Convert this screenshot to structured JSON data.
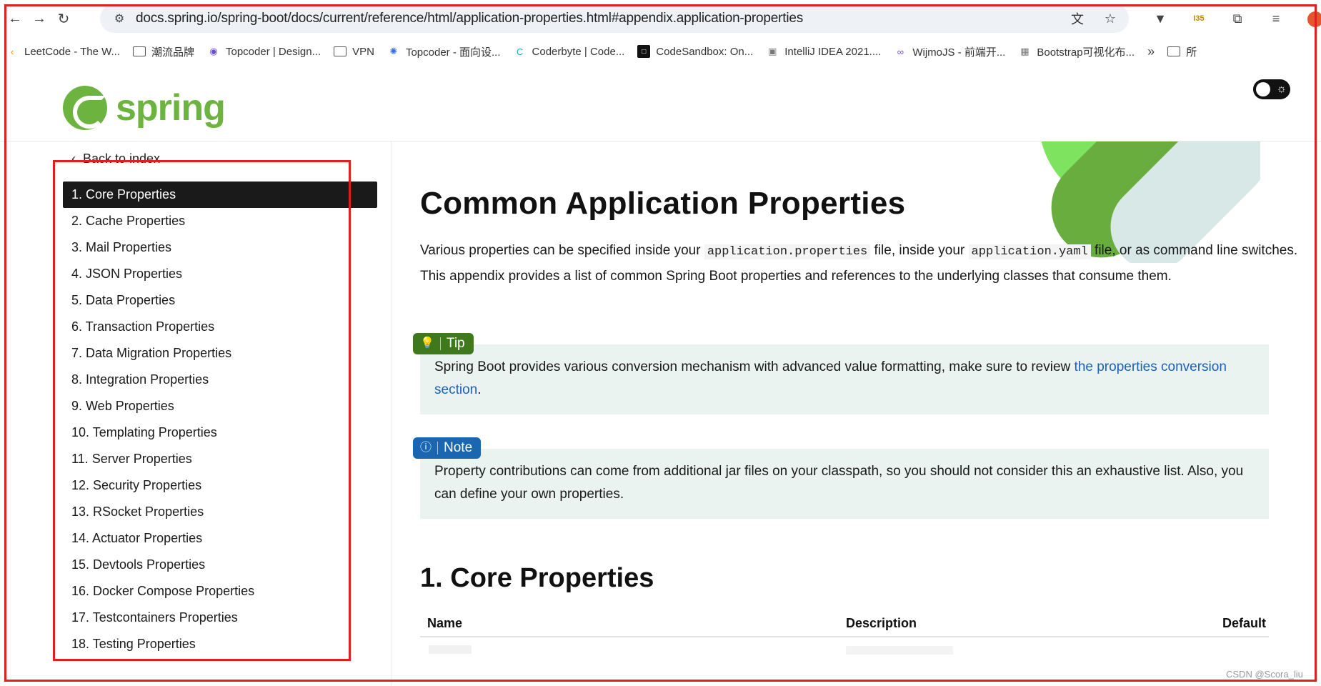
{
  "browser": {
    "url": "docs.spring.io/spring-boot/docs/current/reference/html/application-properties.html#appendix.application-properties",
    "bookmarks": [
      {
        "label": "LeetCode - The W...",
        "icon": "leetcode-icon"
      },
      {
        "label": "潮流品牌",
        "icon": "folder-icon"
      },
      {
        "label": "Topcoder | Design...",
        "icon": "topcoder-icon"
      },
      {
        "label": "VPN",
        "icon": "folder-icon"
      },
      {
        "label": "Topcoder - 面向设...",
        "icon": "topcoder-icon"
      },
      {
        "label": "Coderbyte | Code...",
        "icon": "coderbyte-icon"
      },
      {
        "label": "CodeSandbox: On...",
        "icon": "codesandbox-icon"
      },
      {
        "label": "IntelliJ IDEA 2021....",
        "icon": "intellij-icon"
      },
      {
        "label": "WijmoJS - 前端开...",
        "icon": "wijmo-icon"
      },
      {
        "label": "Bootstrap可视化布...",
        "icon": "bootstrap-icon"
      }
    ],
    "more_label": "»",
    "last_bookmark": "所"
  },
  "header": {
    "logo_text": "spring"
  },
  "sidebar": {
    "back_label": "Back to index",
    "items": [
      {
        "label": "1. Core Properties",
        "active": true
      },
      {
        "label": "2. Cache Properties"
      },
      {
        "label": "3. Mail Properties"
      },
      {
        "label": "4. JSON Properties"
      },
      {
        "label": "5. Data Properties"
      },
      {
        "label": "6. Transaction Properties"
      },
      {
        "label": "7. Data Migration Properties"
      },
      {
        "label": "8. Integration Properties"
      },
      {
        "label": "9. Web Properties"
      },
      {
        "label": "10. Templating Properties"
      },
      {
        "label": "11. Server Properties"
      },
      {
        "label": "12. Security Properties"
      },
      {
        "label": "13. RSocket Properties"
      },
      {
        "label": "14. Actuator Properties"
      },
      {
        "label": "15. Devtools Properties"
      },
      {
        "label": "16. Docker Compose Properties"
      },
      {
        "label": "17. Testcontainers Properties"
      },
      {
        "label": "18. Testing Properties"
      }
    ]
  },
  "main": {
    "title": "Common Application Properties",
    "intro_1": "Various properties can be specified inside your ",
    "intro_code_1": "application.properties",
    "intro_2": " file, inside your ",
    "intro_code_2": "application.yaml",
    "intro_3": " file, or as command line switches. This appendix provides a list of common Spring Boot properties and references to the underlying classes that consume them.",
    "tip": {
      "label": "Tip",
      "text": "Spring Boot provides various conversion mechanism with advanced value formatting, make sure to review ",
      "link": "the properties conversion section",
      "after": "."
    },
    "note": {
      "label": "Note",
      "text": "Property contributions can come from additional jar files on your classpath, so you should not consider this an exhaustive list. Also, you can define your own properties."
    },
    "section_title": "1. Core Properties",
    "table_headers": [
      "Name",
      "Description",
      "Default"
    ]
  },
  "watermark": "CSDN @Scora_liu",
  "colors": {
    "spring_green": "#6db33f",
    "tip_green": "#3e7a1c",
    "note_blue": "#1a66b1",
    "annotation_red": "#e0201f"
  }
}
